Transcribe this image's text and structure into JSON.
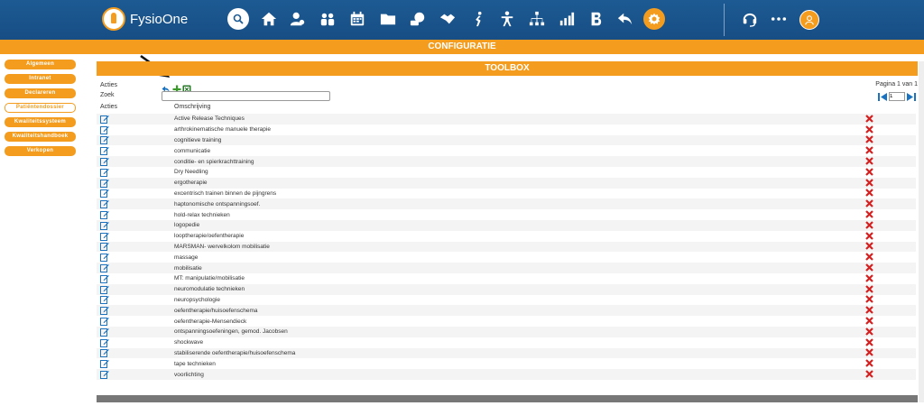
{
  "app": {
    "name": "FysioOne"
  },
  "config_bar": {
    "title": "CONFIGURATIE"
  },
  "sidebar": {
    "items": [
      {
        "label": "Algemeen",
        "active": false
      },
      {
        "label": "Intranet",
        "active": false
      },
      {
        "label": "Declareren",
        "active": false
      },
      {
        "label": "Patiëntendossier",
        "active": true
      },
      {
        "label": "Kwaliteitssysteem",
        "active": false
      },
      {
        "label": "Kwaliteitshandboek",
        "active": false
      },
      {
        "label": "Verkopen",
        "active": false
      }
    ]
  },
  "toolbox": {
    "title": "TOOLBOX",
    "acties_label": "Acties",
    "zoek_label": "Zoek",
    "search_value": "",
    "col_acties": "Acties",
    "col_omschrijving": "Omschrijving",
    "pager_text": "Pagina 1 van 1",
    "page_value": "1",
    "rows": [
      "Active Release Techniques",
      "arthrokinematische manuele therapie",
      "cognitieve training",
      "communicatie",
      "conditie- en spierkrachttraining",
      "Dry Needling",
      "ergotherapie",
      "excentrisch trainen binnen de pijngrens",
      "haptonomische ontspanningsoef.",
      "hold-relax technieken",
      "logopedie",
      "looptherapie/oefentherapie",
      "MARSMAN- wervelkolom mobilisatie",
      "massage",
      "mobilisatie",
      "MT: manipulatie/mobilisatie",
      "neuromodulatie technieken",
      "neuropsychologie",
      "oefentherapie/huisoefenschema",
      "oefentherapie-Mensendieck",
      "ontspanningsoefeningen, gemod. Jacobsen",
      "shockwave",
      "stabiliserende oefentherapie/huisoefenschema",
      "tape technieken",
      "voorlichting"
    ]
  },
  "colors": {
    "nav_blue": "#1d5a93",
    "accent_orange": "#f39c1e",
    "delete_red": "#d42020",
    "link_blue": "#1a73c0"
  },
  "icons": {
    "nav": [
      "search-icon",
      "home-icon",
      "patient-icon",
      "users-icon",
      "calendar-icon",
      "folder-icon",
      "finance-icon",
      "handshake-icon",
      "exercise-icon",
      "person-icon",
      "hierarchy-icon",
      "chart-icon",
      "b-icon",
      "reply-icon",
      "settings-icon",
      "headset-icon",
      "more-icon",
      "avatar-icon"
    ],
    "row_actions": [
      "edit-icon",
      "delete-icon"
    ],
    "toolbar": [
      "back-icon",
      "add-icon",
      "excel-icon"
    ]
  }
}
